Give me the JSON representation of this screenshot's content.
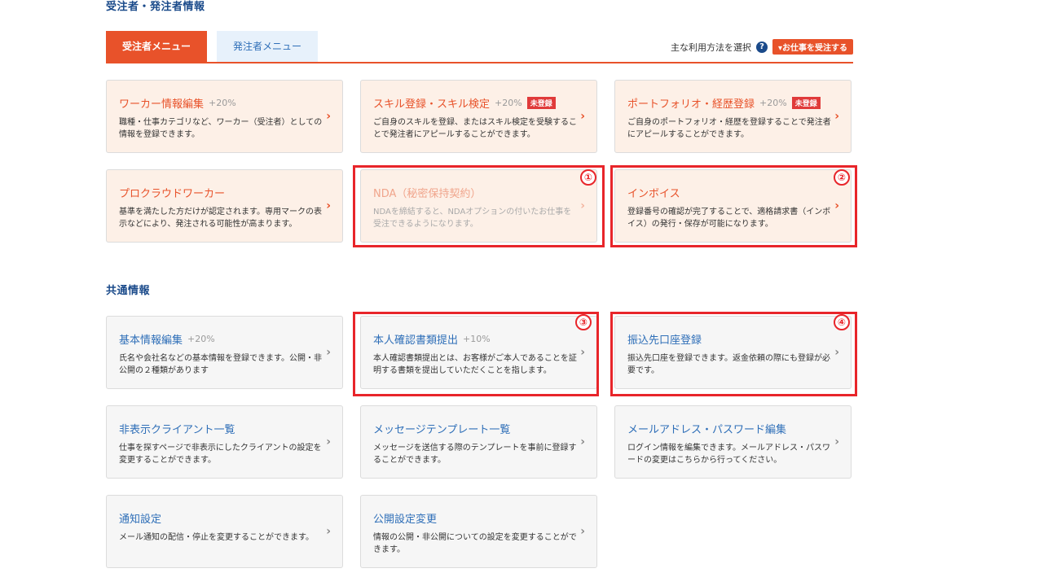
{
  "sections": {
    "contractor_title": "受注者・発注者情報",
    "common_title": "共通情報"
  },
  "tabs": {
    "active": "受注者メニュー",
    "inactive": "発注者メニュー"
  },
  "method": {
    "label": "主な利用方法を選択",
    "help_icon": "?",
    "order_button": "▾お仕事を受注する"
  },
  "contractor_cards": [
    {
      "title": "ワーカー情報編集",
      "pct": "+20%",
      "badge": "",
      "desc": "職種・仕事カテゴリなど、ワーカー（受注者）としての情報を登録できます。"
    },
    {
      "title": "スキル登録・スキル検定",
      "pct": "+20%",
      "badge": "未登録",
      "desc": "ご自身のスキルを登録、またはスキル検定を受験することで発注者にアピールすることができます。"
    },
    {
      "title": "ポートフォリオ・経歴登録",
      "pct": "+20%",
      "badge": "未登録",
      "desc": "ご自身のポートフォリオ・経歴を登録することで発注者にアピールすることができます。"
    },
    {
      "title": "プロクラウドワーカー",
      "pct": "",
      "badge": "",
      "desc": "基準を満たした方だけが認定されます。専用マークの表示などにより、発注される可能性が高まります。"
    },
    {
      "title": "NDA（秘密保持契約）",
      "pct": "",
      "badge": "",
      "desc": "NDAを締結すると、NDAオプションの付いたお仕事を受注できるようになります。"
    },
    {
      "title": "インボイス",
      "pct": "",
      "badge": "",
      "desc": "登録番号の確認が完了することで、適格請求書（インボイス）の発行・保存が可能になります。"
    }
  ],
  "common_cards": [
    {
      "title": "基本情報編集",
      "pct": "+20%",
      "desc": "氏名や会社名などの基本情報を登録できます。公開・非公開の２種類があります"
    },
    {
      "title": "本人確認書類提出",
      "pct": "+10%",
      "desc": "本人確認書類提出とは、お客様がご本人であることを証明する書類を提出していただくことを指します。"
    },
    {
      "title": "振込先口座登録",
      "pct": "",
      "desc": "振込先口座を登録できます。返金依頼の際にも登録が必要です。"
    },
    {
      "title": "非表示クライアント一覧",
      "pct": "",
      "desc": "仕事を探すページで非表示にしたクライアントの設定を変更することができます。"
    },
    {
      "title": "メッセージテンプレート一覧",
      "pct": "",
      "desc": "メッセージを送信する際のテンプレートを事前に登録することができます。"
    },
    {
      "title": "メールアドレス・パスワード編集",
      "pct": "",
      "desc": "ログイン情報を編集できます。メールアドレス・パスワードの変更はこちらから行ってください。"
    },
    {
      "title": "通知設定",
      "pct": "",
      "desc": "メール通知の配信・停止を変更することができます。"
    },
    {
      "title": "公開設定変更",
      "pct": "",
      "desc": "情報の公開・非公開についての設定を変更することができます。"
    }
  ],
  "annotations": [
    "①",
    "②",
    "③",
    "④"
  ],
  "chevron": "›"
}
